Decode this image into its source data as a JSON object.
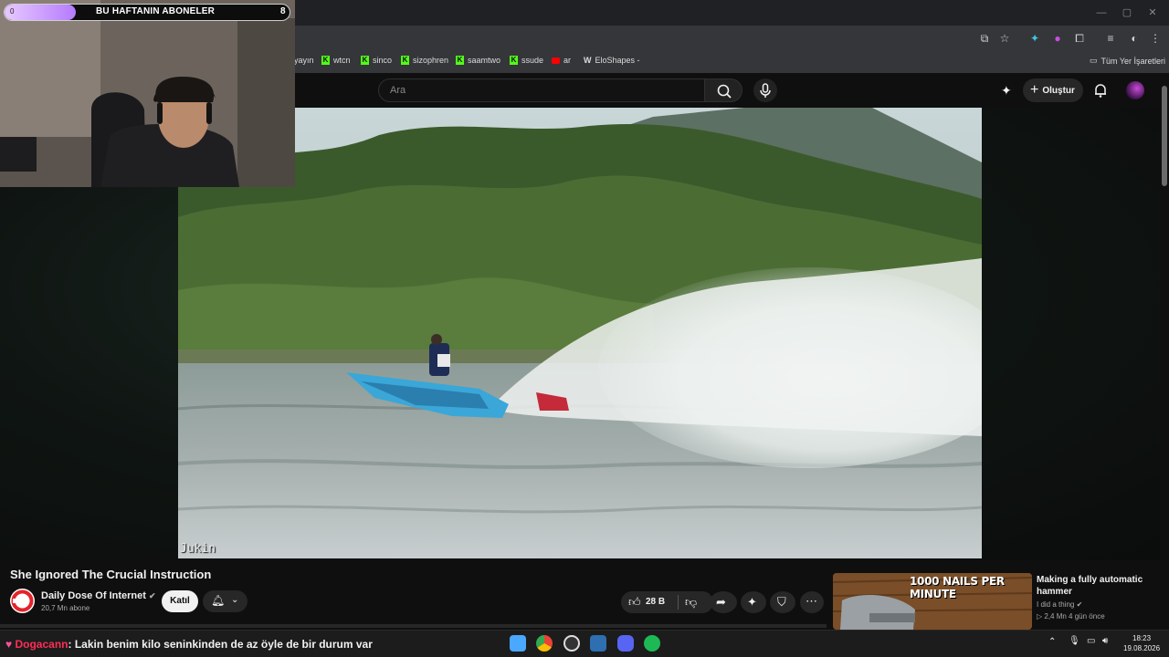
{
  "browser": {
    "bookmarks": [
      {
        "label": "yayın",
        "icon": "none"
      },
      {
        "label": "wtcn",
        "icon": "kick-icon"
      },
      {
        "label": "sinco",
        "icon": "kick-icon"
      },
      {
        "label": "sizophren",
        "icon": "kick-icon"
      },
      {
        "label": "saamtwo",
        "icon": "kick-icon"
      },
      {
        "label": "ssude",
        "icon": "kick-icon"
      },
      {
        "label": "ar",
        "icon": "youtube-icon"
      },
      {
        "label": "EloShapes -",
        "icon": "eloshapes-icon"
      }
    ],
    "all_bookmarks_label": "Tüm Yer İşaretleri"
  },
  "youtube": {
    "search_placeholder": "Ara",
    "create_label": "Oluştur"
  },
  "overlay": {
    "sub_goal_label": "BU HAFTANIN ABONELER",
    "sub_goal_count": "8",
    "sub_goal_progress": 0.25,
    "bar_start": "0"
  },
  "video": {
    "watermark": "Jukin",
    "title": "She Ignored The Crucial Instruction",
    "channel_name": "Daily Dose Of Internet",
    "channel_subs": "20,7 Mn abone",
    "join_label": "Katıl",
    "like_count": "28 B"
  },
  "recommendation": {
    "thumb_text": "1000 NAILS PER MINUTE",
    "title": "Making a fully automatic hammer",
    "channel": "I did a thing",
    "meta": "2,4 Mn  4 gün önce"
  },
  "chat": {
    "user": "Dogacann",
    "message": ": Lakin benim kilo seninkinden de az öyle de bir durum var"
  },
  "clock": {
    "time": "18:23",
    "date": "19.08.2026"
  },
  "colors": {
    "kick_green": "#53fc18",
    "youtube_red": "#ff0000",
    "chat_user": "#ff2d55"
  }
}
